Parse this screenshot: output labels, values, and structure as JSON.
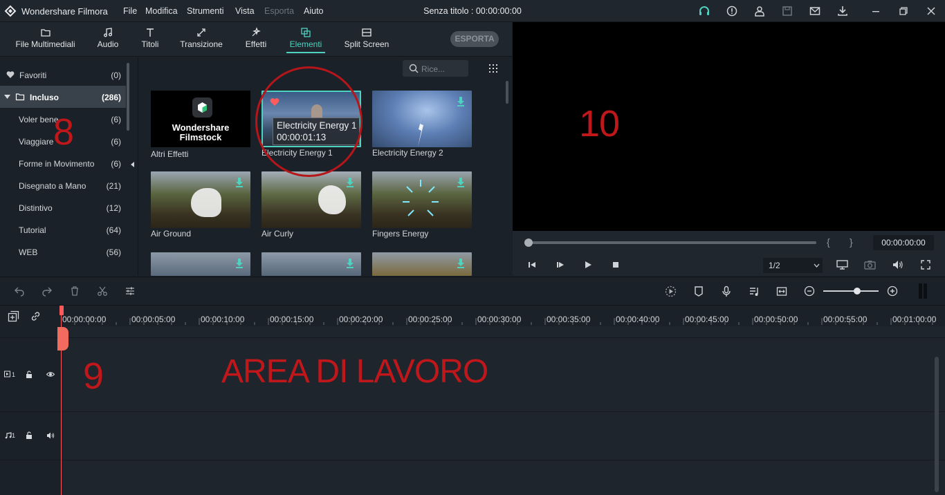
{
  "app": {
    "name": "Wondershare Filmora",
    "window_title": "Senza titolo : 00:00:00:00",
    "menu": [
      "File",
      "Modifica",
      "Strumenti",
      "Vista",
      "Esporta",
      "Aiuto"
    ],
    "titlebar_icons": [
      "headset-icon",
      "info-icon",
      "account-icon",
      "save-icon",
      "mail-icon",
      "download-icon",
      "minimize-icon",
      "restore-icon",
      "close-icon"
    ]
  },
  "toolbar": {
    "tabs": [
      "File Multimediali",
      "Audio",
      "Titoli",
      "Transizione",
      "Effetti",
      "Elementi",
      "Split Screen"
    ],
    "active_tab": "Elementi",
    "export_label": "ESPORTA"
  },
  "sidebar": {
    "items": [
      {
        "label": "Favoriti",
        "count": "(0)"
      },
      {
        "label": "Incluso",
        "count": "(286)"
      },
      {
        "label": "Voler bene",
        "count": "(6)"
      },
      {
        "label": "Viaggiare",
        "count": "(6)"
      },
      {
        "label": "Forme in Movimento",
        "count": "(6)"
      },
      {
        "label": "Disegnato a Mano",
        "count": "(21)"
      },
      {
        "label": "Distintivo",
        "count": "(12)"
      },
      {
        "label": "Tutorial",
        "count": "(64)"
      },
      {
        "label": "WEB",
        "count": "(56)"
      }
    ],
    "selected": "Incluso"
  },
  "library": {
    "search_placeholder": "Rice...",
    "filmstock_line1": "Wondershare",
    "filmstock_line2": "Filmstock",
    "items": [
      "Altri Effetti",
      "Electricity Energy 1",
      "Electricity Energy 2",
      "Air Ground",
      "Air Curly",
      "Fingers Energy"
    ],
    "tooltip": {
      "title": "Electricity Energy 1",
      "duration": "00:00:01:13"
    }
  },
  "preview": {
    "timecode": "00:00:00:00",
    "ratio": "1/2",
    "brace_open": "{",
    "brace_close": "}"
  },
  "timeline": {
    "ruler": [
      "00:00:00:00",
      "00:00:05:00",
      "00:00:10:00",
      "00:00:15:00",
      "00:00:20:00",
      "00:00:25:00",
      "00:00:30:00",
      "00:00:35:00",
      "00:00:40:00",
      "00:00:45:00",
      "00:00:50:00",
      "00:00:55:00",
      "00:01:00:00"
    ],
    "video_track": "1",
    "audio_track": "1"
  },
  "annotations": {
    "n8": "8",
    "n9": "9",
    "n10": "10",
    "work_area": "AREA DI LAVORO"
  },
  "colors": {
    "accent": "#4fd3c1",
    "annotation": "#c0171b",
    "playhead": "#ff5a5a"
  }
}
